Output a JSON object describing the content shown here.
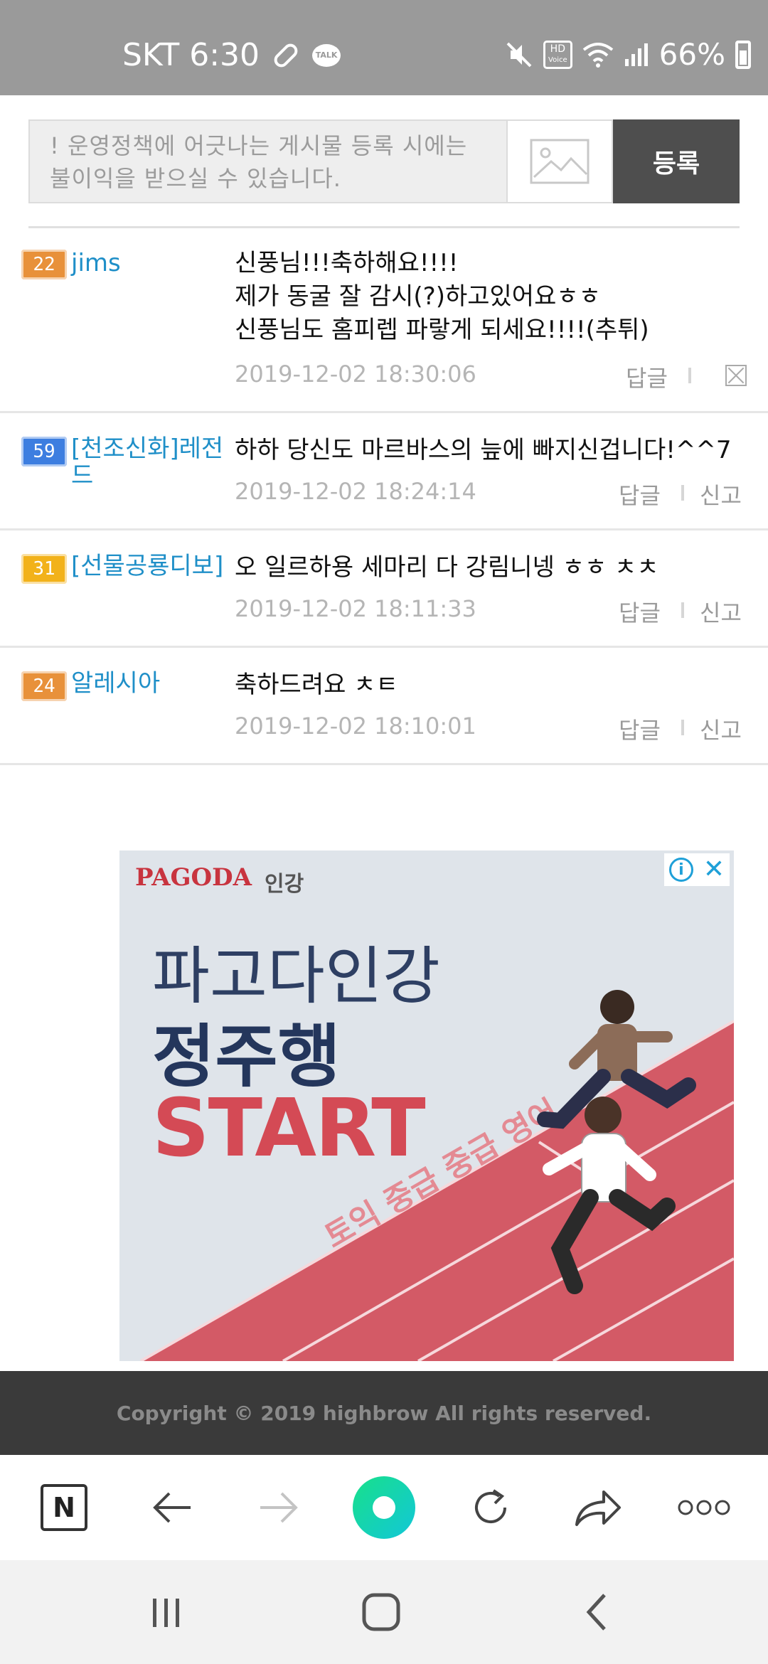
{
  "status_bar": {
    "carrier_time": "SKT 6:30",
    "talk_badge": "TALK",
    "hd_label": "HD",
    "voice_label": "Voice",
    "battery": "66%"
  },
  "form": {
    "notice": "! 운영정책에 어긋나는 게시물 등록 시에는 불이익을 받으실 수 있습니다.",
    "submit_label": "등록"
  },
  "comments": [
    {
      "level": "22",
      "nickname": "jims",
      "lines": [
        "신풍님!!!축하해요!!!!",
        "제가 동굴 잘 감시(?)하고있어요ㅎㅎ",
        "신풍님도 홈피렙 파랗게 되세요!!!!(추튀)"
      ],
      "date": "2019-12-02 18:30:06",
      "reply": "답글",
      "report": ""
    },
    {
      "level": "59",
      "nickname": "[천조신화]레전드",
      "lines": [
        "하하 당신도 마르바스의 늪에 빠지신겁니다!^^7"
      ],
      "date": "2019-12-02 18:24:14",
      "reply": "답글",
      "report": "신고"
    },
    {
      "level": "31",
      "nickname": "[선물공룡디보]",
      "lines": [
        "오 일르하용 세마리 다 강림니넹 ㅎㅎ ㅊㅊ"
      ],
      "date": "2019-12-02 18:11:33",
      "reply": "답글",
      "report": "신고"
    },
    {
      "level": "24",
      "nickname": "알레시아",
      "lines": [
        "축하드려요 ㅊㅌ"
      ],
      "date": "2019-12-02 18:10:01",
      "reply": "답글",
      "report": "신고"
    }
  ],
  "ad": {
    "brand": "PAGODA",
    "brand_sub": "인강",
    "line1": "파고다인강",
    "line2": "정주행",
    "line3": "START",
    "track_text": "토익 중급 중급 영어"
  },
  "footer": {
    "copyright": "Copyright © 2019 highbrow All rights reserved."
  },
  "toolbar": {
    "n_label": "N"
  },
  "colors": {
    "status_bar": "#9a9a9a",
    "nickname": "#1f8fc8",
    "submit_bg": "#4e4e4e",
    "footer_bg": "#3a3a3a"
  }
}
